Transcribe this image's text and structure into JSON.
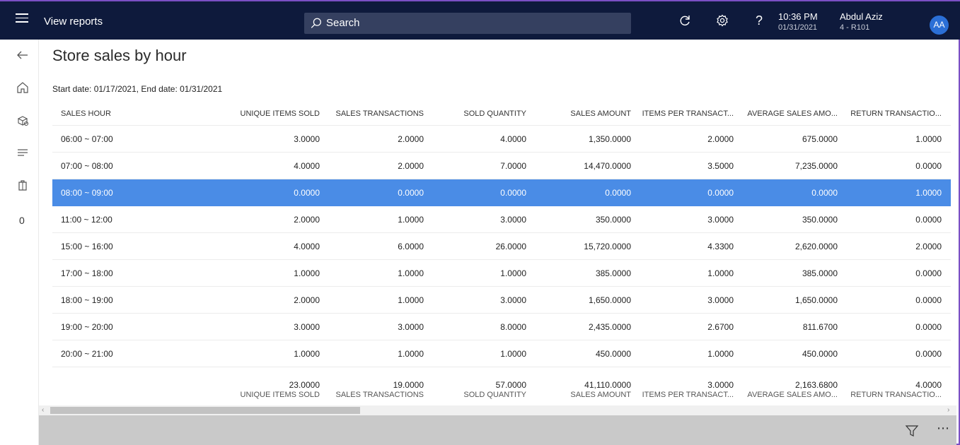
{
  "topbar": {
    "title": "View reports",
    "search_placeholder": "Search",
    "time": "10:36 PM",
    "date": "01/31/2021",
    "user_name": "Abdul Aziz",
    "store": "4 - R101",
    "avatar_initials": "AA"
  },
  "rail": {
    "count": "0"
  },
  "page": {
    "title": "Store sales by hour",
    "date_range": "Start date: 01/17/2021, End date: 01/31/2021"
  },
  "table": {
    "columns": [
      "SALES HOUR",
      "UNIQUE ITEMS SOLD",
      "SALES TRANSACTIONS",
      "SOLD QUANTITY",
      "SALES AMOUNT",
      "ITEMS PER TRANSACT...",
      "AVERAGE SALES AMO...",
      "RETURN TRANSACTIO..."
    ],
    "rows": [
      [
        "06:00 ~ 07:00",
        "3.0000",
        "2.0000",
        "4.0000",
        "1,350.0000",
        "2.0000",
        "675.0000",
        "1.0000"
      ],
      [
        "07:00 ~ 08:00",
        "4.0000",
        "2.0000",
        "7.0000",
        "14,470.0000",
        "3.5000",
        "7,235.0000",
        "0.0000"
      ],
      [
        "08:00 ~ 09:00",
        "0.0000",
        "0.0000",
        "0.0000",
        "0.0000",
        "0.0000",
        "0.0000",
        "1.0000"
      ],
      [
        "11:00 ~ 12:00",
        "2.0000",
        "1.0000",
        "3.0000",
        "350.0000",
        "3.0000",
        "350.0000",
        "0.0000"
      ],
      [
        "15:00 ~ 16:00",
        "4.0000",
        "6.0000",
        "26.0000",
        "15,720.0000",
        "4.3300",
        "2,620.0000",
        "2.0000"
      ],
      [
        "17:00 ~ 18:00",
        "1.0000",
        "1.0000",
        "1.0000",
        "385.0000",
        "1.0000",
        "385.0000",
        "0.0000"
      ],
      [
        "18:00 ~ 19:00",
        "2.0000",
        "1.0000",
        "3.0000",
        "1,650.0000",
        "3.0000",
        "1,650.0000",
        "0.0000"
      ],
      [
        "19:00 ~ 20:00",
        "3.0000",
        "3.0000",
        "8.0000",
        "2,435.0000",
        "2.6700",
        "811.6700",
        "0.0000"
      ],
      [
        "20:00 ~ 21:00",
        "1.0000",
        "1.0000",
        "1.0000",
        "450.0000",
        "1.0000",
        "450.0000",
        "0.0000"
      ]
    ],
    "selected_row": 2,
    "totals": [
      {
        "value": "23.0000",
        "label": "UNIQUE ITEMS SOLD"
      },
      {
        "value": "19.0000",
        "label": "SALES TRANSACTIONS"
      },
      {
        "value": "57.0000",
        "label": "SOLD QUANTITY"
      },
      {
        "value": "41,110.0000",
        "label": "SALES AMOUNT"
      },
      {
        "value": "3.0000",
        "label": "ITEMS PER TRANSACT..."
      },
      {
        "value": "2,163.6800",
        "label": "AVERAGE SALES AMO..."
      },
      {
        "value": "4.0000",
        "label": "RETURN TRANSACTIO..."
      }
    ]
  },
  "colors": {
    "topbar": "#0e1a3c",
    "selected": "#4a8ce6",
    "avatar": "#2b6fd6",
    "action_bar": "#c9c9c9"
  }
}
